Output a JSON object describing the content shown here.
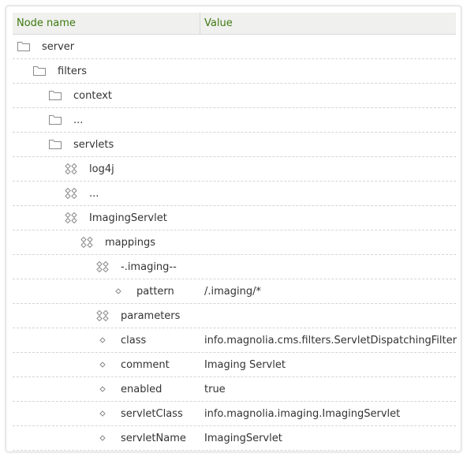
{
  "header": {
    "name_label": "Node name",
    "value_label": "Value"
  },
  "colors": {
    "header_text": "#3e7a10",
    "header_bg": "#f0f0ee",
    "icon_stroke": "#8a8a8a"
  },
  "rows": [
    {
      "name": "server",
      "value": "",
      "icon": "folder-icon",
      "level": 0
    },
    {
      "name": "filters",
      "value": "",
      "icon": "folder-icon",
      "level": 1
    },
    {
      "name": "context",
      "value": "",
      "icon": "folder-icon",
      "level": 2
    },
    {
      "name": "...",
      "value": "",
      "icon": "folder-icon",
      "level": 2
    },
    {
      "name": "servlets",
      "value": "",
      "icon": "folder-icon",
      "level": 2
    },
    {
      "name": "log4j",
      "value": "",
      "icon": "content-node-icon",
      "level": 3
    },
    {
      "name": "...",
      "value": "",
      "icon": "content-node-icon",
      "level": 3
    },
    {
      "name": "ImagingServlet",
      "value": "",
      "icon": "content-node-icon",
      "level": 3
    },
    {
      "name": "mappings",
      "value": "",
      "icon": "content-node-icon",
      "level": 4
    },
    {
      "name": "-.imaging--",
      "value": "",
      "icon": "content-node-icon",
      "level": 5
    },
    {
      "name": "pattern",
      "value": "/.imaging/*",
      "icon": "property-icon",
      "level": 6
    },
    {
      "name": "parameters",
      "value": "",
      "icon": "content-node-icon",
      "level": 5
    },
    {
      "name": "class",
      "value": "info.magnolia.cms.filters.ServletDispatchingFilter",
      "icon": "property-icon",
      "level": 5
    },
    {
      "name": "comment",
      "value": "Imaging Servlet",
      "icon": "property-icon",
      "level": 5
    },
    {
      "name": "enabled",
      "value": "true",
      "icon": "property-icon",
      "level": 5
    },
    {
      "name": "servletClass",
      "value": "info.magnolia.imaging.ImagingServlet",
      "icon": "property-icon",
      "level": 5
    },
    {
      "name": "servletName",
      "value": "ImagingServlet",
      "icon": "property-icon",
      "level": 5
    }
  ]
}
